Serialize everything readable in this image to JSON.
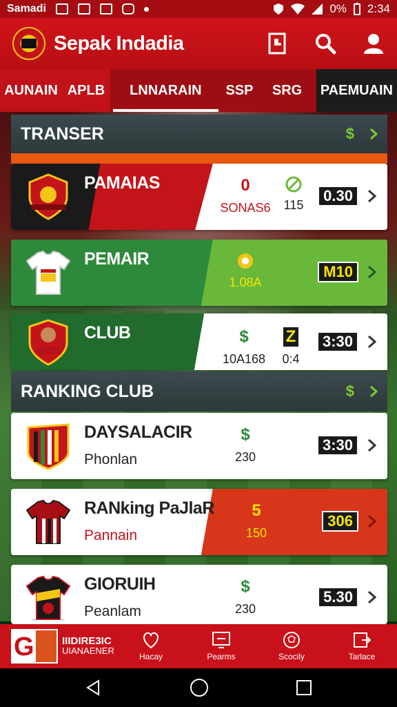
{
  "status_bar": {
    "app": "Samadi",
    "time": "2:34",
    "battery": "0%"
  },
  "header": {
    "title": "Sepak Indadia"
  },
  "tabs": [
    {
      "label": "AUNAIN"
    },
    {
      "label": "APLB"
    },
    {
      "label": "LNNARAIN"
    },
    {
      "label": "SSP"
    },
    {
      "label": "SRG"
    },
    {
      "label": "PAEMUAIN"
    }
  ],
  "sections": {
    "transfer": {
      "title": "TRANSER",
      "icon_text": "$"
    },
    "ranking": {
      "title": "RANKING CLUB",
      "icon_text": "$"
    }
  },
  "transfer_cards": [
    {
      "title": "PAMAIAS",
      "mid1_top": "0",
      "mid1_bot": "SONAS6",
      "mid2_bot": "115",
      "score": "0.30"
    },
    {
      "title": "PEMAIR",
      "mid1_bot": "1.08A",
      "score": "M10"
    },
    {
      "title": "CLUB",
      "mid1_top": "$",
      "mid1_bot": "10A168",
      "mid2_top": "Z",
      "mid2_bot": "0:4",
      "score": "3:30"
    }
  ],
  "ranking_cards": [
    {
      "title": "DAYSALACIR",
      "subtitle": "Phonlan",
      "mid_top": "$",
      "mid_bot": "230",
      "score": "3:30"
    },
    {
      "title": "RANking PaJlaR",
      "subtitle": "Pannain",
      "mid_top": "5",
      "mid_bot": "150",
      "score": "306"
    },
    {
      "title": "GIORUIH",
      "subtitle": "Peanlam",
      "mid_top": "$",
      "mid_bot": "230",
      "score": "5.30"
    }
  ],
  "bottom_nav": {
    "promo": {
      "letter": "G",
      "line1": "IIIDIRE3IC",
      "line2": "UIANAENER"
    },
    "items": [
      {
        "label": "Hacay",
        "icon": "heart-icon"
      },
      {
        "label": "Pearms",
        "icon": "tv-icon"
      },
      {
        "label": "Scocily",
        "icon": "ball-icon"
      },
      {
        "label": "Tarlace",
        "icon": "share-icon"
      }
    ]
  },
  "colors": {
    "primary": "#c8111a",
    "dark": "#1a1a1a",
    "green": "#2d8a3a",
    "accent_green": "#7ecb2e",
    "orange": "#d8361a"
  }
}
